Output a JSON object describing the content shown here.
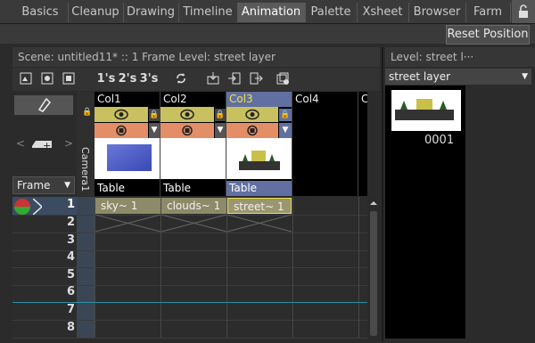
{
  "tabs": [
    "Basics",
    "Cleanup",
    "Drawing",
    "Timeline",
    "Animation",
    "Palette",
    "Xsheet",
    "Browser",
    "Farm"
  ],
  "active_tab": "Animation",
  "reset_button": "Reset Position",
  "scene_header": "Scene: untitled11*   ::   1 Frame  Level: street layer",
  "level_header": "Level:   street l···",
  "level_dropdown": "street layer",
  "level_frame": "0001",
  "toolbar_icons": [
    "new-vector-icon",
    "new-toonz-icon",
    "new-raster-icon",
    "step-1s-icon",
    "step-2s-icon",
    "step-3s-icon",
    "reframe-icon",
    "load-icon",
    "import-icon",
    "export-icon",
    "save-icon"
  ],
  "step_labels": [
    "1's",
    "2's",
    "3's"
  ],
  "frame_selector": "Frame",
  "camera_label": "Camera1",
  "columns": [
    {
      "name": "Col1",
      "label": "Table"
    },
    {
      "name": "Col2",
      "label": "Table"
    },
    {
      "name": "Col3",
      "label": "Table"
    },
    {
      "name": "Col4",
      "label": ""
    },
    {
      "name": "C",
      "label": ""
    }
  ],
  "cells": [
    "sky~ 1",
    "clouds~ 1",
    "street~ 1"
  ],
  "rows": [
    "1",
    "2",
    "3",
    "4",
    "5",
    "6",
    "7",
    "8"
  ]
}
